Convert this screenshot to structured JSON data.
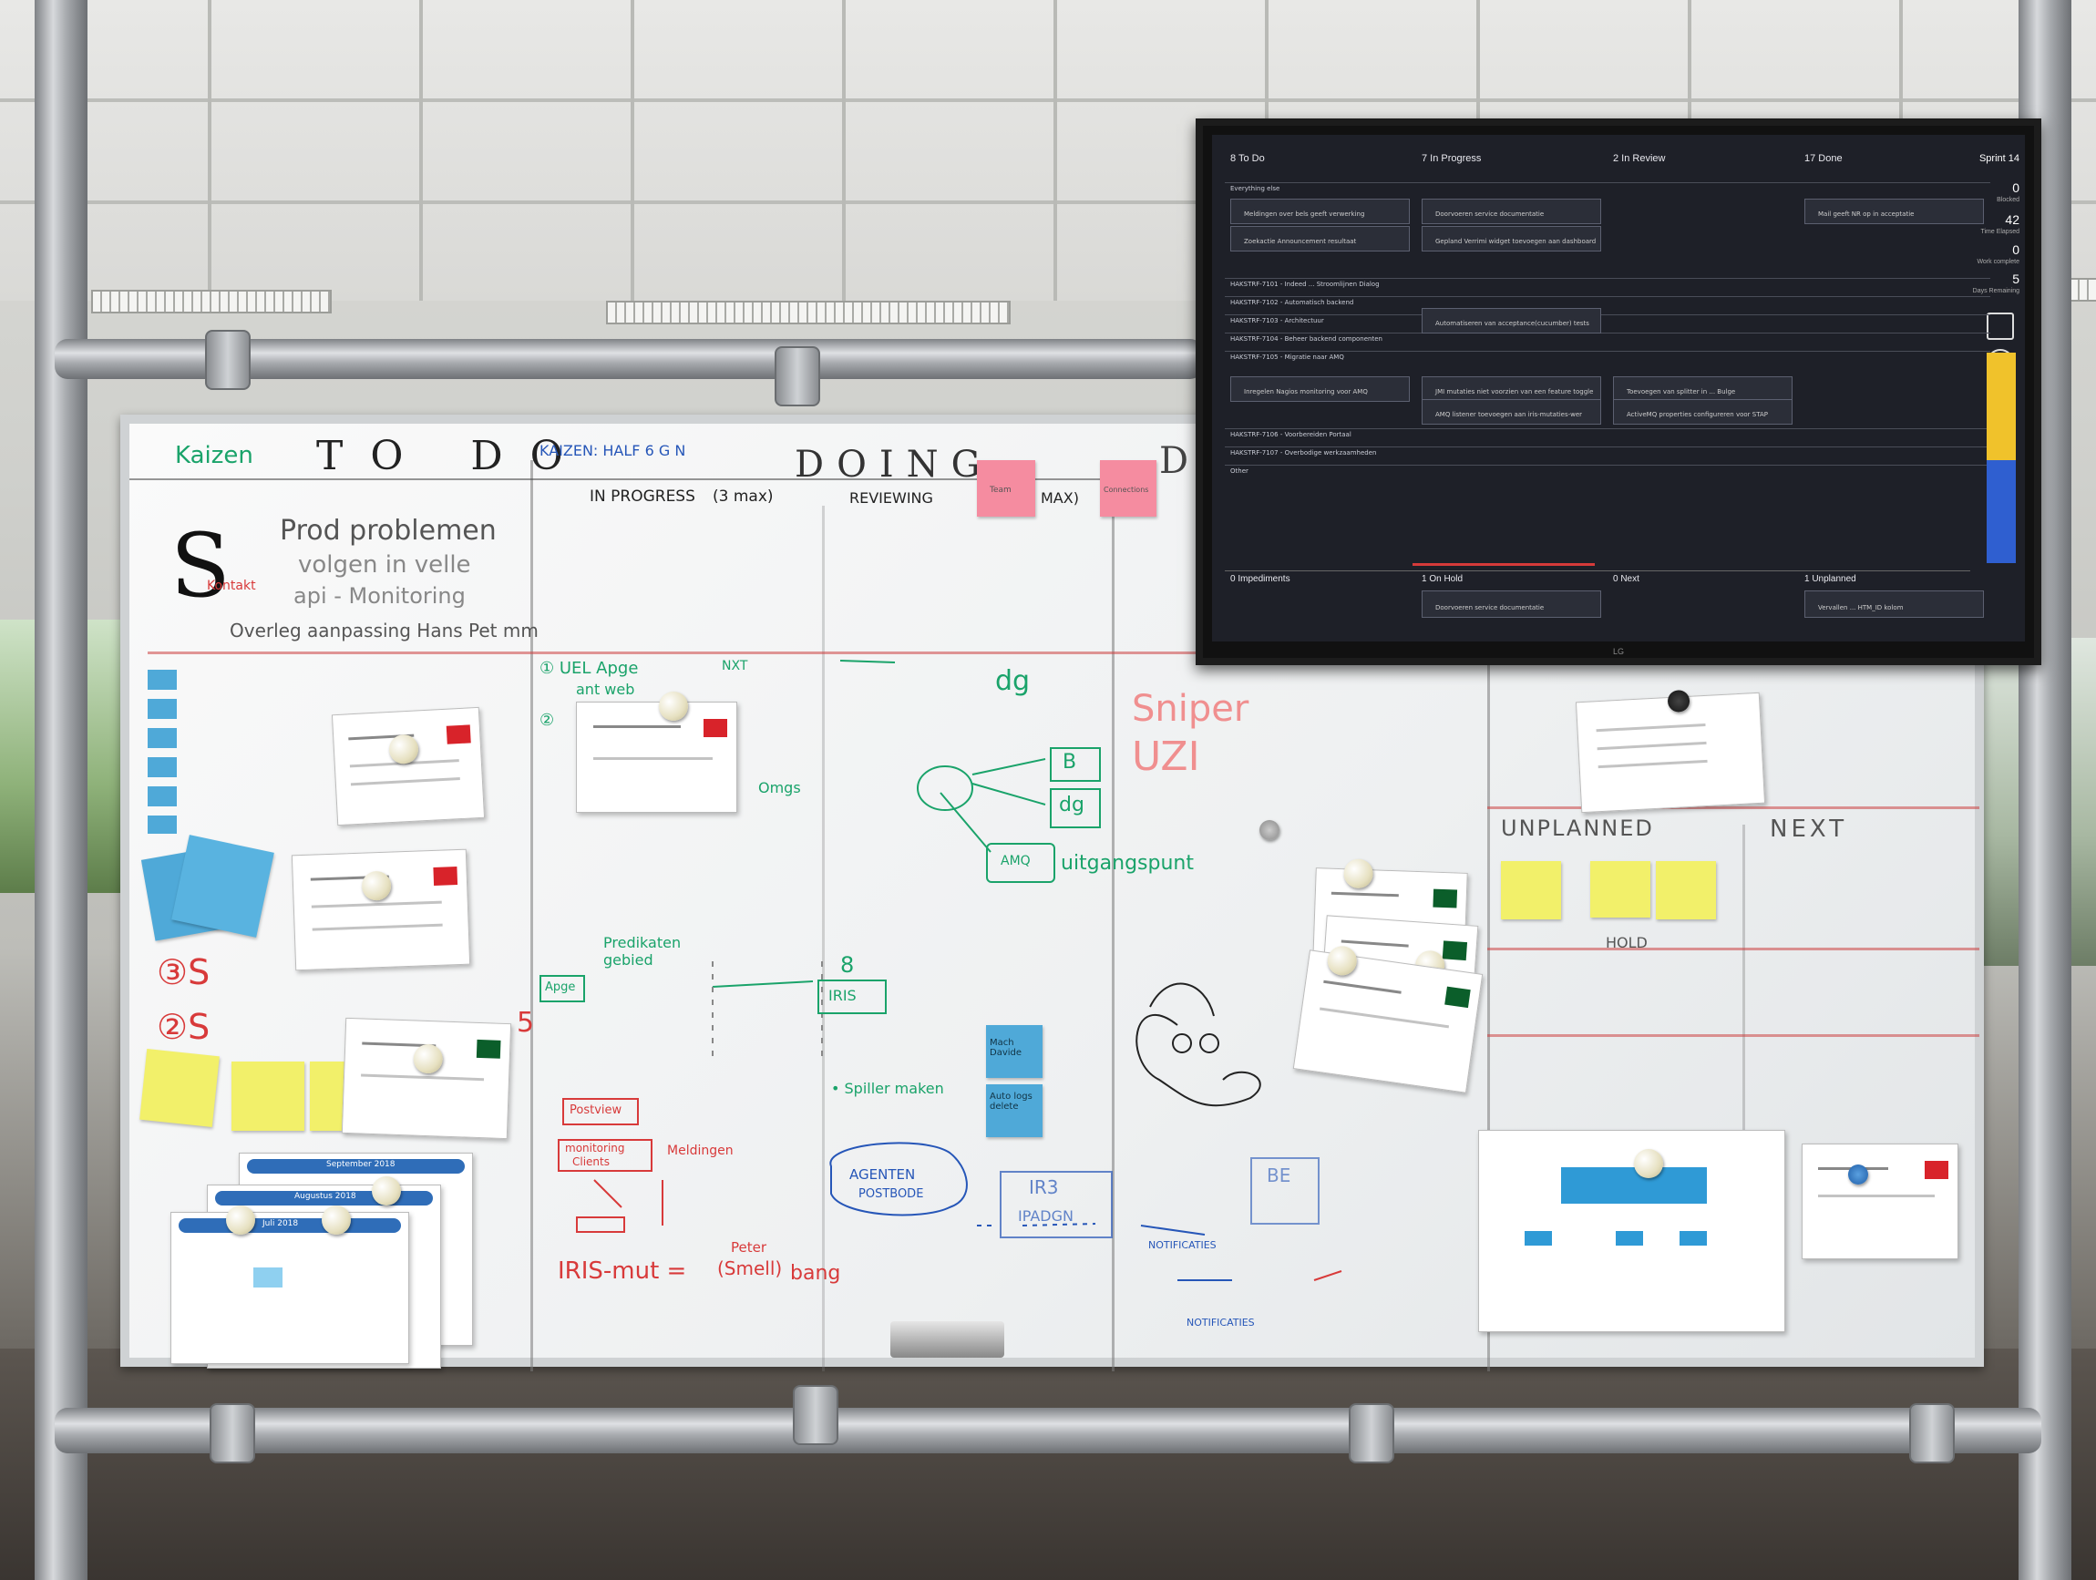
{
  "scene": {
    "description_tag": "office whiteboard with kanban board and wall-mounted TV",
    "colors": {
      "sticky_yellow": "#f2f06a",
      "sticky_pink": "#f58ca0",
      "sticky_blue": "#4fa9d8",
      "marker_green": "#1aa36a",
      "marker_red": "#d83a3a",
      "marker_black": "#222222",
      "tv_bg": "#1e2028",
      "tv_accent_yellow": "#f0c22b",
      "tv_accent_blue": "#2f5fd0"
    }
  },
  "whiteboard": {
    "header": {
      "kaizen_tag": "Kaizen",
      "todo": "TO DO",
      "kaizen_label": "KAIZEN: HALF 6 G N",
      "doing": "DOING",
      "in_progress": "IN PROGRESS",
      "in_progress_limit": "(3 max)",
      "reviewing": "REVIEWING",
      "reviewing_limit": "MAX)",
      "done_fragment": "D"
    },
    "priority_block": {
      "letter": "S",
      "side_note": "Kontakt",
      "items": [
        "Prod problemen",
        "volgen in velle",
        "api - Monitoring",
        "Overleg aanpassing Hans Pet mm"
      ]
    },
    "lane_markers": [
      "③S",
      "②S"
    ],
    "doing_notes": {
      "step1": "① UEL Apge",
      "step1b": "ant web",
      "step1_arrow": "NXT",
      "step2": "②",
      "dg": "dg",
      "omgs": "Omgs",
      "box_b": "B",
      "box_dg": "dg",
      "box_amq": "AMQ",
      "uitgangspunt": "uitgangspunt",
      "predikaten": "Predikaten gebied",
      "apge": "Apge",
      "iris": "IRIS",
      "eight": "8",
      "spiller": "• Spiller maken",
      "postview": "Postview",
      "monitoring": "monitoring",
      "clients": "Clients",
      "meldingen": "Meldingen",
      "iris_mut": "IRIS-mut = ",
      "peter": "Peter",
      "smell": "(Smell)",
      "bang": "bang",
      "agenten": "AGENTEN",
      "postbode": "POSTBODE",
      "ir3": "IR3",
      "ipadgn": "IPADGN",
      "notificaties": "NOTIFICATIES",
      "notificaties2": "NOTIFICATIES",
      "be": "BE",
      "sniper": "Sniper",
      "uzi": "UZI",
      "red_five": "5"
    },
    "right_section": {
      "unplanned": "UNPLANNED",
      "next": "NEXT",
      "hold": "HOLD"
    },
    "sticky_labels": {
      "pink1": "Team",
      "pink2": "Connections",
      "blue1": "Mach Davide",
      "blue2": "Auto logs delete"
    },
    "calendar_labels": [
      "September 2018",
      "Augustus 2018",
      "Juli 2018"
    ]
  },
  "tv_board": {
    "columns": [
      {
        "label": "8 To Do"
      },
      {
        "label": "7 In Progress"
      },
      {
        "label": "2 In Review"
      },
      {
        "label": "17 Done"
      }
    ],
    "sprint_label": "Sprint 14",
    "kpis": [
      {
        "value": "0",
        "label": "Blocked"
      },
      {
        "value": "42",
        "label": "Time Elapsed"
      },
      {
        "value": "0",
        "label": "Work complete"
      },
      {
        "value": "5",
        "label": "Days Remaining"
      }
    ],
    "swimlanes": [
      "Everything else",
      "HAKSTRF-7101 - Indeed ... Stroomlijnen Dialog",
      "HAKSTRF-7102 - Automatisch backend",
      "HAKSTRF-7103 - Architectuur",
      "HAKSTRF-7104 - Beheer backend componenten",
      "HAKSTRF-7105 - Migratie naar AMQ",
      "HAKSTRF-7106 - Voorbereiden Portaal",
      "HAKSTRF-7107 - Overbodige werkzaamheden",
      "Other"
    ],
    "cards": [
      {
        "text": "Meldingen over bels geeft verwerking"
      },
      {
        "text": "Doorvoeren service documentatie"
      },
      {
        "text": "Mail geeft NR op in acceptatie"
      },
      {
        "text": "Zoekactie Announcement resultaat"
      },
      {
        "text": "Gepland Verrimi widget toevoegen aan dashboard"
      },
      {
        "text": "Automatiseren van acceptance(cucumber) tests"
      },
      {
        "text": "Inregelen Nagios monitoring voor AMQ"
      },
      {
        "text": "JMI mutaties niet voorzien van een feature toggle"
      },
      {
        "text": "Toevoegen van splitter in ... Bulge"
      },
      {
        "text": "AMQ listener toevoegen aan iris-mutaties-wer"
      },
      {
        "text": "ActiveMQ properties configureren voor STAP"
      },
      {
        "text": "Doorvoeren service documentatie"
      },
      {
        "text": "Vervallen ... HTM_ID kolom"
      }
    ],
    "bottom_columns": [
      {
        "label": "0 Impediments"
      },
      {
        "label": "1 On Hold"
      },
      {
        "label": "0 Next"
      },
      {
        "label": "1 Unplanned"
      }
    ],
    "progress_fraction": {
      "yellow": 0.47,
      "blue": 0.45
    },
    "brand": "LG"
  }
}
